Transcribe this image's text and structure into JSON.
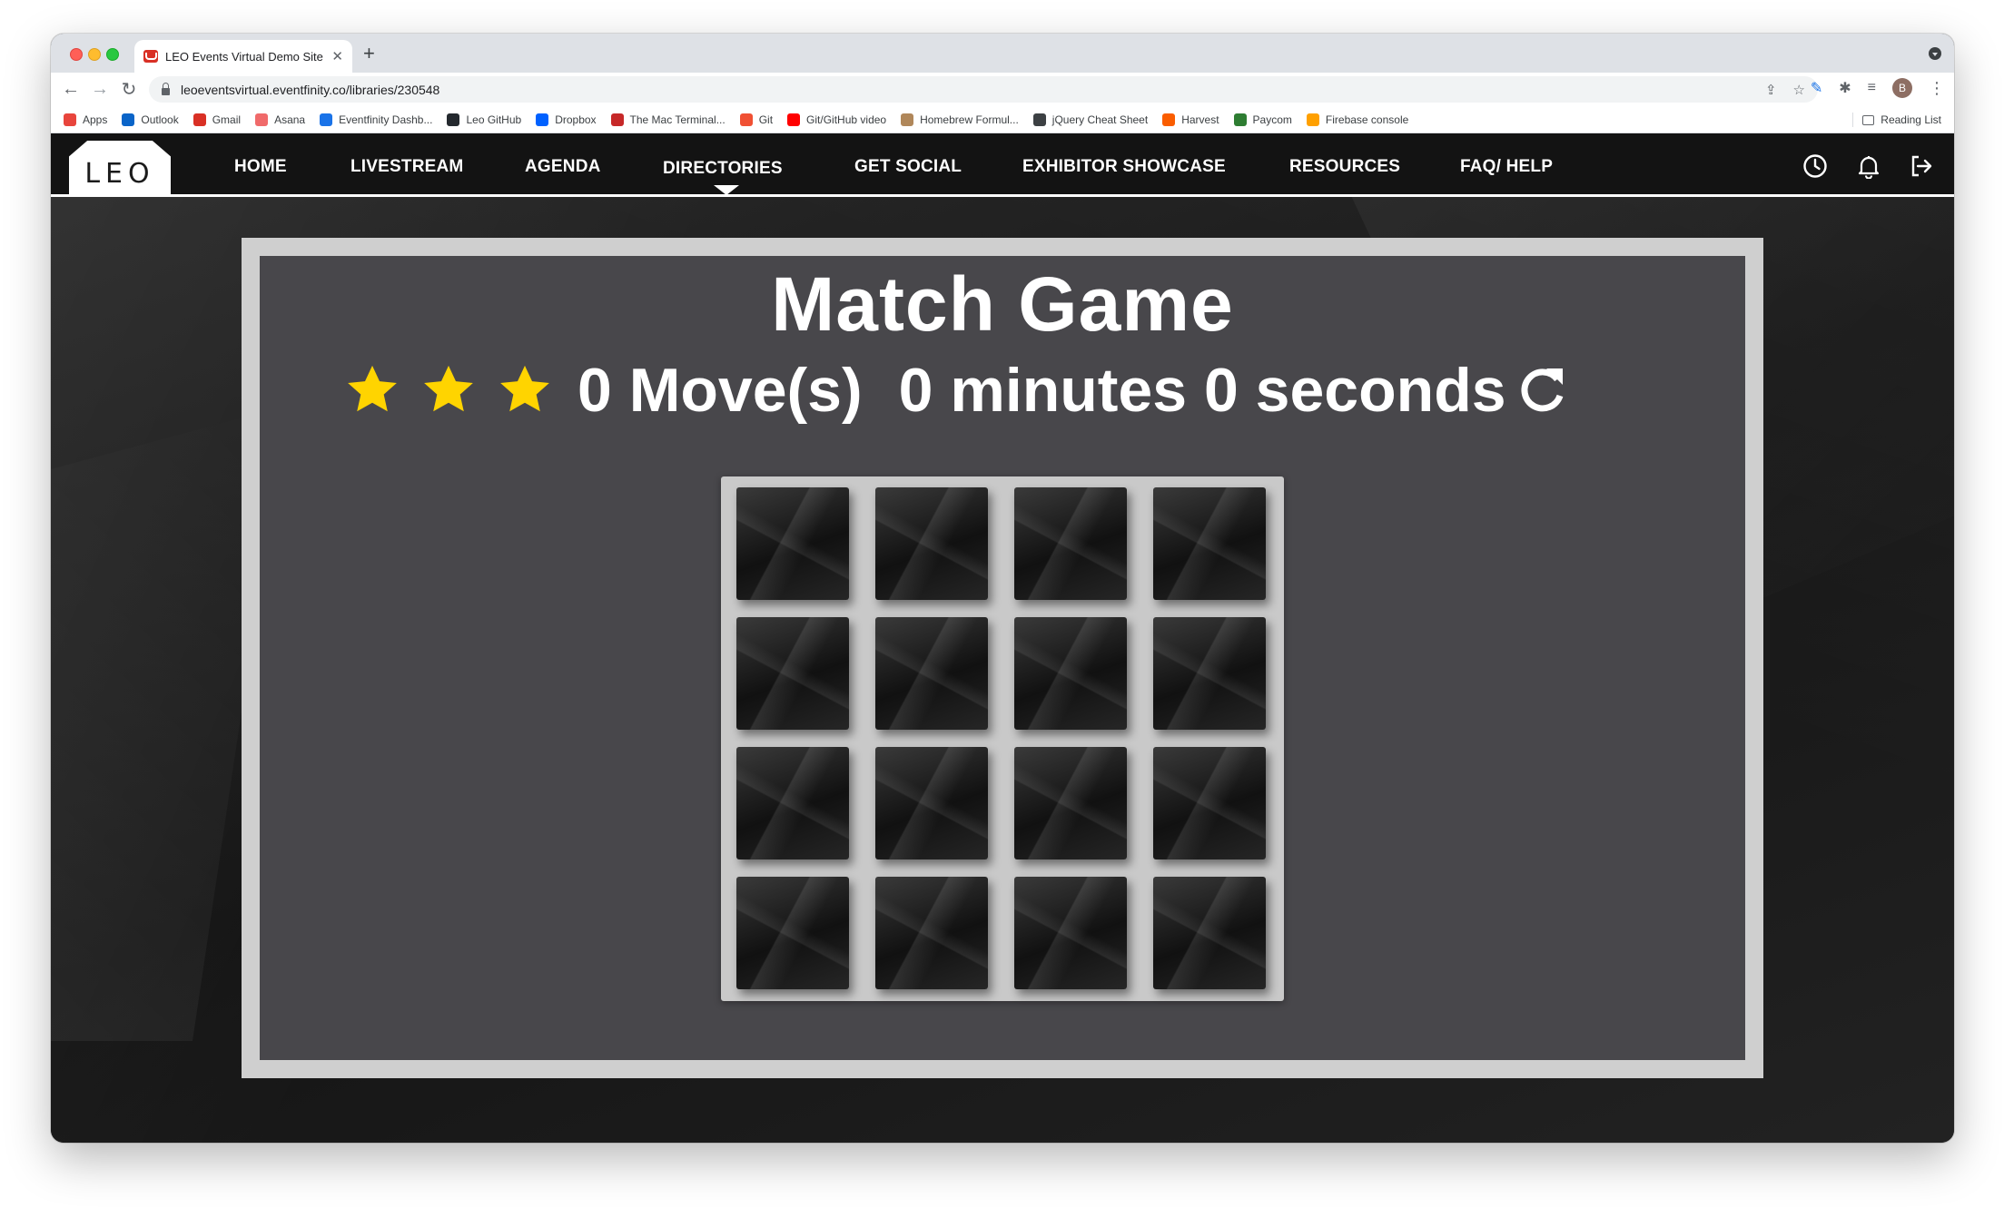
{
  "browser": {
    "tab_title": "LEO Events Virtual Demo Site ·",
    "url": "leoeventsvirtual.eventfinity.co/libraries/230548",
    "bookmarks": [
      {
        "label": "Apps",
        "icon": "apps-grid-icon",
        "color": "#e8453c"
      },
      {
        "label": "Outlook",
        "icon": "outlook-icon",
        "color": "#0a64c8"
      },
      {
        "label": "Gmail",
        "icon": "gmail-icon",
        "color": "#d93025"
      },
      {
        "label": "Asana",
        "icon": "asana-icon",
        "color": "#f06a6a"
      },
      {
        "label": "Eventfinity Dashb...",
        "icon": "eventfinity-icon",
        "color": "#1a73e8"
      },
      {
        "label": "Leo GitHub",
        "icon": "github-icon",
        "color": "#24292e"
      },
      {
        "label": "Dropbox",
        "icon": "dropbox-icon",
        "color": "#0061ff"
      },
      {
        "label": "The Mac Terminal...",
        "icon": "terminal-icon",
        "color": "#c62828"
      },
      {
        "label": "Git",
        "icon": "git-icon",
        "color": "#f05033"
      },
      {
        "label": "Git/GitHub video",
        "icon": "youtube-icon",
        "color": "#ff0000"
      },
      {
        "label": "Homebrew Formul...",
        "icon": "homebrew-icon",
        "color": "#b0875a"
      },
      {
        "label": "jQuery Cheat Sheet",
        "icon": "jquery-icon",
        "color": "#3c4043"
      },
      {
        "label": "Harvest",
        "icon": "harvest-icon",
        "color": "#fa5d00"
      },
      {
        "label": "Paycom",
        "icon": "paycom-icon",
        "color": "#2e7d32"
      },
      {
        "label": "Firebase console",
        "icon": "firebase-icon",
        "color": "#ffa000"
      }
    ],
    "reading_list": "Reading List",
    "avatar_letter": "B"
  },
  "site": {
    "logo_text": "LEO",
    "nav": [
      "HOME",
      "LIVESTREAM",
      "AGENDA",
      "DIRECTORIES",
      "GET SOCIAL",
      "EXHIBITOR SHOWCASE",
      "RESOURCES",
      "FAQ/ HELP"
    ],
    "active_nav": "DIRECTORIES",
    "right_icons": [
      "clock-icon",
      "bell-icon",
      "logout-icon"
    ]
  },
  "game": {
    "title": "Match Game",
    "stars": 3,
    "star_color": "#ffd400",
    "moves_text": "0 Move(s)",
    "timer_text": "0 minutes 0 seconds",
    "restart_icon": "restart-icon",
    "grid_rows": 4,
    "grid_cols": 4,
    "cards_face_down": 16
  }
}
